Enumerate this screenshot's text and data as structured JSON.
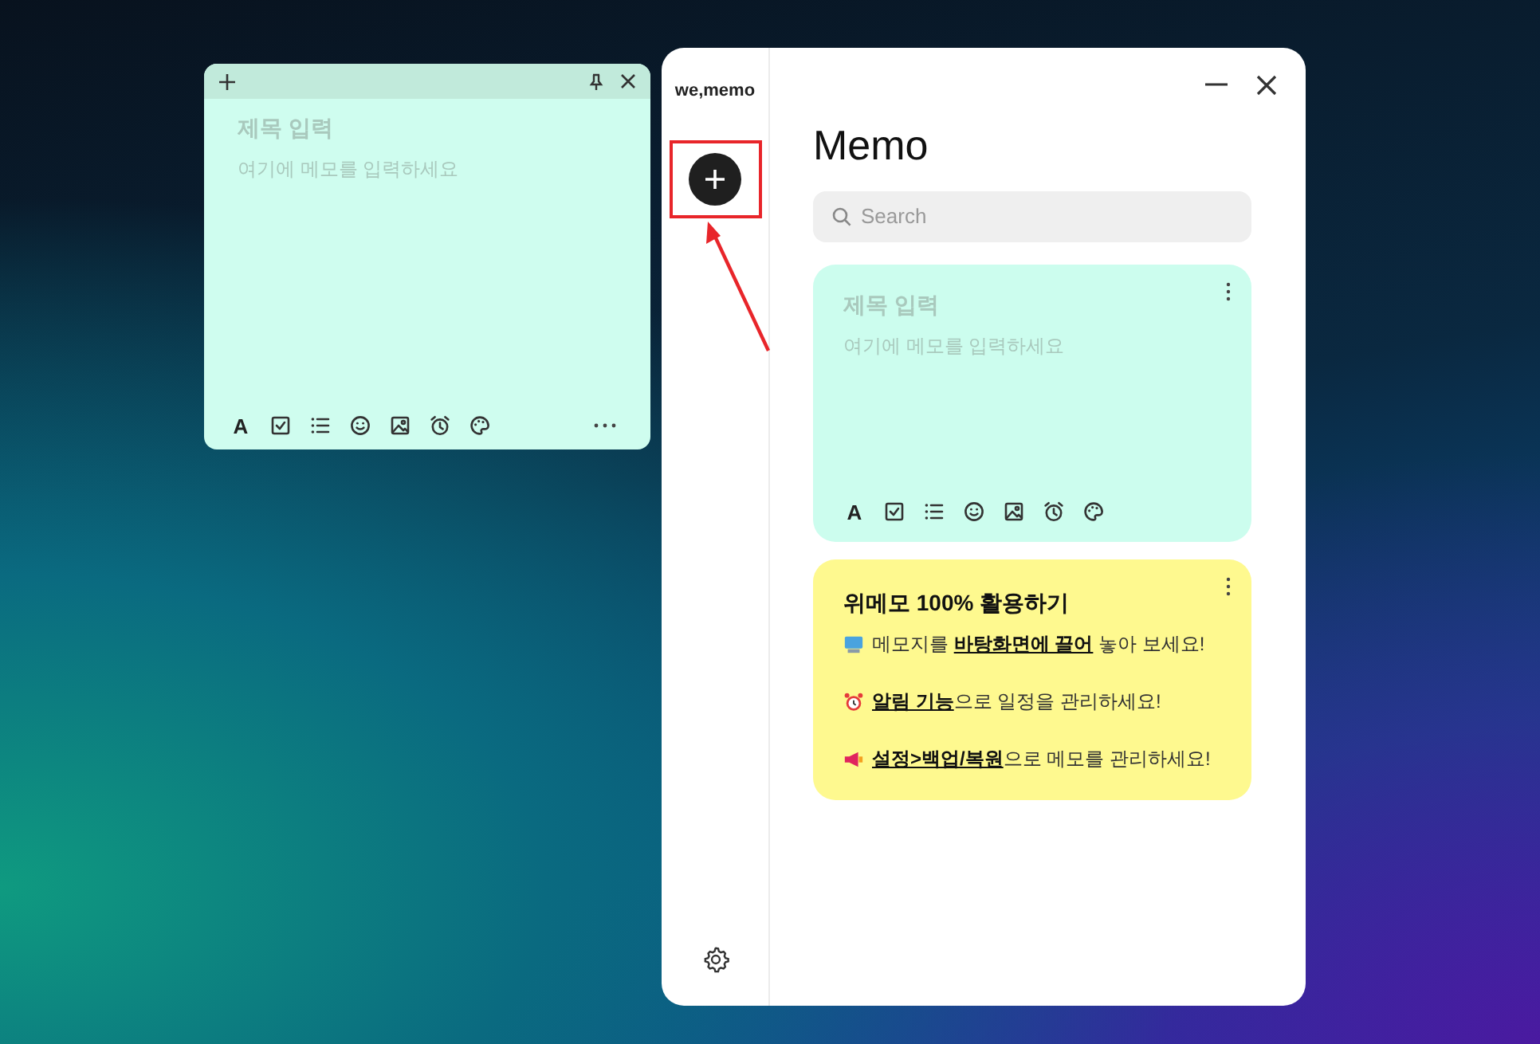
{
  "floating_note": {
    "title_placeholder": "제목 입력",
    "body_placeholder": "여기에 메모를 입력하세요",
    "toolbar": {
      "format_label": "A",
      "tools": [
        {
          "kind": "checkbox"
        },
        {
          "kind": "list"
        },
        {
          "kind": "emoji"
        },
        {
          "kind": "image"
        },
        {
          "kind": "alarm"
        },
        {
          "kind": "palette"
        }
      ]
    }
  },
  "app": {
    "logo": "we,memo",
    "title": "Memo",
    "search": {
      "placeholder": "Search"
    },
    "notes": [
      {
        "kind": "empty",
        "color": "#ccfdee",
        "title_placeholder": "제목 입력",
        "body_placeholder": "여기에 메모를 입력하세요",
        "toolbar": {
          "format_label": "A",
          "tools": [
            {
              "kind": "checkbox"
            },
            {
              "kind": "list"
            },
            {
              "kind": "emoji"
            },
            {
              "kind": "image"
            },
            {
              "kind": "alarm"
            },
            {
              "kind": "palette"
            }
          ]
        }
      },
      {
        "kind": "text",
        "color": "#fef98f",
        "title": "위메모 100% 활용하기",
        "lines": [
          {
            "kind": "computer",
            "text": "메모지를 **바탕화면에 끌어** 놓아 보세요!"
          },
          {
            "kind": "alarm",
            "text": "**알림 기능**으로 일정을 관리하세요!"
          },
          {
            "kind": "megaphone",
            "text": "**설정>백업/복원**으로 메모를 관리하세요!"
          }
        ]
      }
    ]
  }
}
